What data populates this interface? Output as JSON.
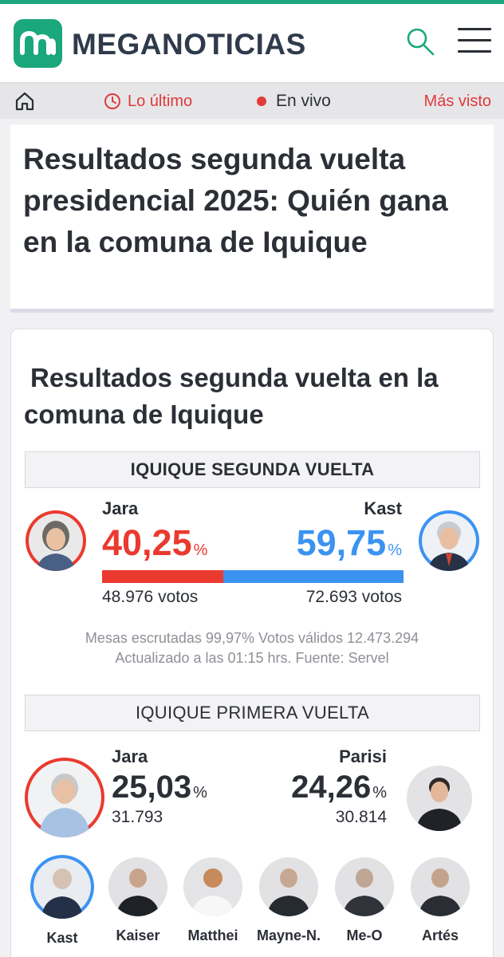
{
  "header": {
    "brand": "MEGANOTICIAS",
    "accent_color": "#1aa77b",
    "icons": [
      "home-icon",
      "search-icon",
      "menu-icon",
      "clock-icon"
    ]
  },
  "nav": {
    "latest_label": "Lo último",
    "live_label": "En vivo",
    "most_seen_label": "Más visto"
  },
  "article": {
    "title": "Resultados segunda vuelta presidencial 2025: Quién gana en la comuna de Iquique"
  },
  "results": {
    "heading": "Resultados segunda vuelta en la comuna de Iquique",
    "second_round": {
      "band": "IQUIQUE SEGUNDA VUELTA",
      "left": {
        "name": "Jara",
        "pct": "40,25",
        "votes": "48.976 votos",
        "color": "#ea3a2f"
      },
      "right": {
        "name": "Kast",
        "pct": "59,75",
        "votes": "72.693 votos",
        "color": "#3b93f1"
      },
      "percent_sign": "%",
      "share_left": 0.4025,
      "meta_line1": "Mesas escrutadas 99,97% Votos válidos 12.473.294",
      "meta_line2": "Actualizado a las 01:15 hrs. Fuente: Servel"
    },
    "first_round": {
      "band": "IQUIQUE PRIMERA VUELTA",
      "left": {
        "name": "Jara",
        "pct": "25,03",
        "votes": "31.793"
      },
      "right": {
        "name": "Parisi",
        "pct": "24,26",
        "votes": "30.814"
      },
      "others": [
        "Kast",
        "Kaiser",
        "Matthei",
        "Mayne-N.",
        "Me-O",
        "Artés"
      ]
    }
  }
}
